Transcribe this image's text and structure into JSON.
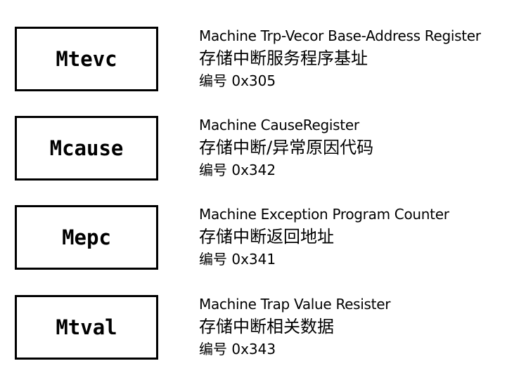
{
  "registers": [
    {
      "name": "Mtevc",
      "english": "Machine Trp-Vecor Base-Address Register",
      "chinese": "存储中断服务程序基址",
      "code": "编号 0x305"
    },
    {
      "name": "Mcause",
      "english": "Machine CauseRegister",
      "chinese": "存储中断/异常原因代码",
      "code": "编号 0x342"
    },
    {
      "name": "Mepc",
      "english": "Machine Exception Program Counter",
      "chinese": "存储中断返回地址",
      "code": "编号 0x341"
    },
    {
      "name": "Mtval",
      "english": "Machine Trap Value Resister",
      "chinese": "存储中断相关数据",
      "code": "编号 0x343"
    }
  ]
}
